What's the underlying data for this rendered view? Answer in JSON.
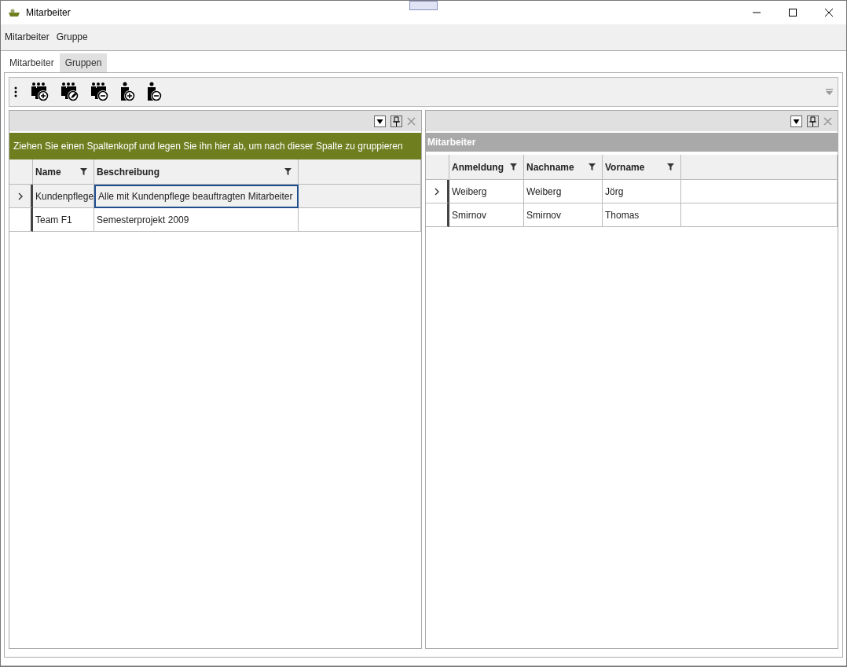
{
  "window": {
    "title": "Mitarbeiter"
  },
  "menu": [
    "Mitarbeiter",
    "Gruppe"
  ],
  "tabs": [
    {
      "label": "Mitarbeiter",
      "selected": false
    },
    {
      "label": "Gruppen",
      "selected": true
    }
  ],
  "toolbar": {
    "buttons": [
      {
        "kind": "group-add"
      },
      {
        "kind": "group-edit"
      },
      {
        "kind": "group-remove"
      },
      {
        "kind": "person-add"
      },
      {
        "kind": "person-remove"
      }
    ]
  },
  "left_panel": {
    "group_hint": "Ziehen Sie einen Spaltenkopf und legen Sie ihn hier ab, um nach dieser Spalte zu gruppieren",
    "columns": [
      {
        "label": "Name"
      },
      {
        "label": "Beschreibung"
      }
    ],
    "rows": [
      {
        "current": true,
        "cells": [
          {
            "text": "Kundenpflege",
            "focused": false
          },
          {
            "text": "Alle mit Kundenpflege beauftragten Mitarbeiter",
            "focused": true
          }
        ]
      },
      {
        "current": false,
        "cells": [
          {
            "text": "Team F1",
            "focused": false
          },
          {
            "text": "Semesterprojekt 2009",
            "focused": false
          }
        ]
      }
    ]
  },
  "right_panel": {
    "caption": "Mitarbeiter",
    "columns": [
      {
        "label": "Anmeldung"
      },
      {
        "label": "Nachname"
      },
      {
        "label": "Vorname"
      }
    ],
    "rows": [
      {
        "current": true,
        "cells": [
          {
            "text": "Weiberg",
            "focused": false
          },
          {
            "text": "Weiberg",
            "focused": false
          },
          {
            "text": "Jörg",
            "focused": false
          }
        ]
      },
      {
        "current": false,
        "cells": [
          {
            "text": "Smirnov",
            "focused": false
          },
          {
            "text": "Smirnov",
            "focused": false
          },
          {
            "text": "Thomas",
            "focused": false
          }
        ]
      }
    ]
  }
}
